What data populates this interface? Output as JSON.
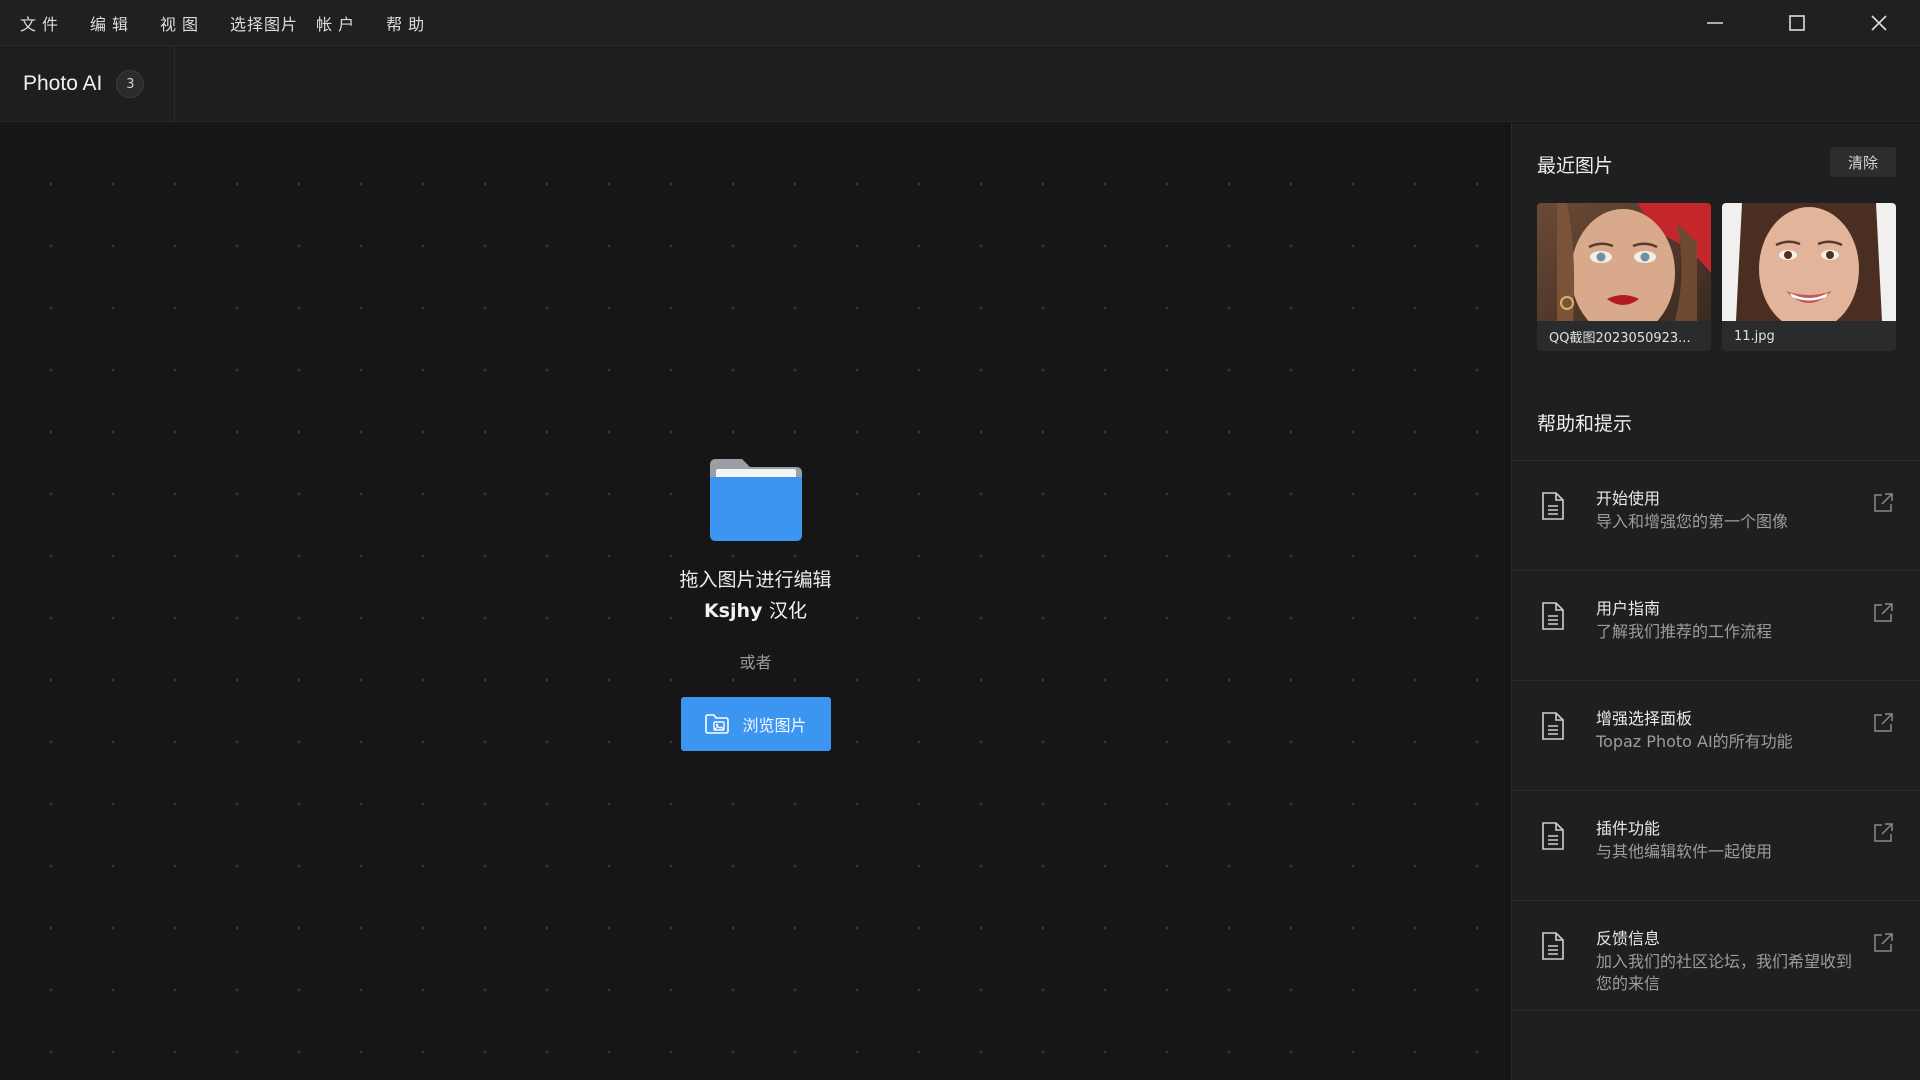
{
  "menubar": {
    "items": [
      "文件",
      "编辑",
      "视图",
      "选择图片",
      "帐户",
      "帮助"
    ]
  },
  "app": {
    "title": "Photo AI",
    "badge": "3"
  },
  "drop": {
    "line1": "拖入图片进行编辑",
    "line2_brand": "Ksjhy",
    "line2_suffix": "汉化",
    "or": "或者",
    "browse_label": "浏览图片"
  },
  "panel": {
    "recent_title": "最近图片",
    "clear_label": "清除",
    "recent": [
      {
        "name": "QQ截图2023050923..."
      },
      {
        "name": "11.jpg"
      }
    ],
    "help_title": "帮助和提示",
    "help": [
      {
        "title": "开始使用",
        "desc": "导入和增强您的第一个图像"
      },
      {
        "title": "用户指南",
        "desc": "了解我们推荐的工作流程"
      },
      {
        "title": "增强选择面板",
        "desc": "Topaz Photo AI的所有功能"
      },
      {
        "title": "插件功能",
        "desc": "与其他编辑软件一起使用"
      },
      {
        "title": "反馈信息",
        "desc": "加入我们的社区论坛，我们希望收到您的来信"
      }
    ]
  },
  "colors": {
    "accent": "#3d95f2",
    "background": "#161617",
    "panel": "#1e1f20"
  }
}
